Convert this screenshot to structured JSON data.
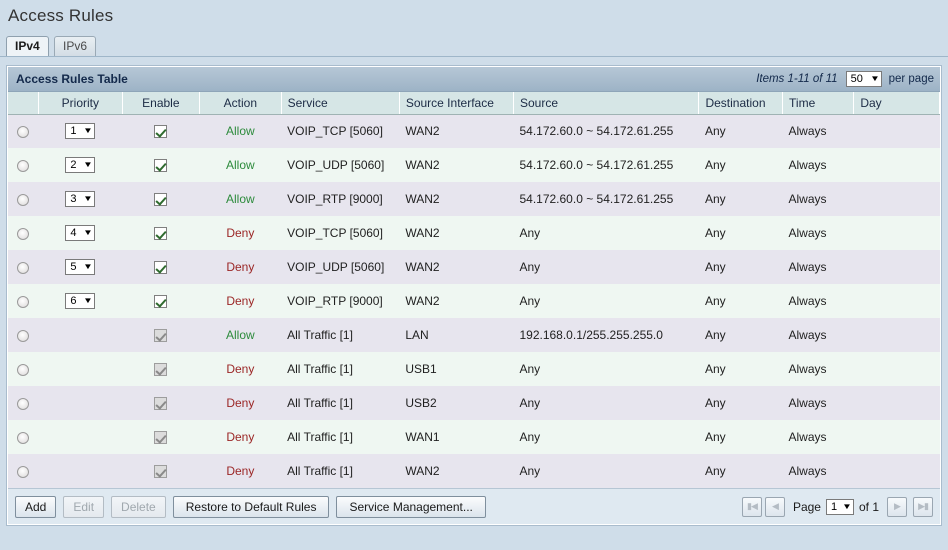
{
  "page": {
    "title": "Access Rules"
  },
  "tabs": [
    {
      "label": "IPv4",
      "active": true
    },
    {
      "label": "IPv6",
      "active": false
    }
  ],
  "table": {
    "caption": "Access Rules Table",
    "items_count": "Items 1-11 of 11",
    "page_size": "50",
    "per_page_label": "per page",
    "columns": [
      "",
      "Priority",
      "Enable",
      "Action",
      "Service",
      "Source Interface",
      "Source",
      "Destination",
      "Time",
      "Day"
    ],
    "rows": [
      {
        "priority": "1",
        "enable": true,
        "enable_disabled": false,
        "action": "Allow",
        "service": "VOIP_TCP [5060]",
        "source_interface": "WAN2",
        "source": "54.172.60.0 ~ 54.172.61.255",
        "destination": "Any",
        "time": "Always",
        "day": ""
      },
      {
        "priority": "2",
        "enable": true,
        "enable_disabled": false,
        "action": "Allow",
        "service": "VOIP_UDP [5060]",
        "source_interface": "WAN2",
        "source": "54.172.60.0 ~ 54.172.61.255",
        "destination": "Any",
        "time": "Always",
        "day": ""
      },
      {
        "priority": "3",
        "enable": true,
        "enable_disabled": false,
        "action": "Allow",
        "service": "VOIP_RTP [9000]",
        "source_interface": "WAN2",
        "source": "54.172.60.0 ~ 54.172.61.255",
        "destination": "Any",
        "time": "Always",
        "day": ""
      },
      {
        "priority": "4",
        "enable": true,
        "enable_disabled": false,
        "action": "Deny",
        "service": "VOIP_TCP [5060]",
        "source_interface": "WAN2",
        "source": "Any",
        "destination": "Any",
        "time": "Always",
        "day": ""
      },
      {
        "priority": "5",
        "enable": true,
        "enable_disabled": false,
        "action": "Deny",
        "service": "VOIP_UDP [5060]",
        "source_interface": "WAN2",
        "source": "Any",
        "destination": "Any",
        "time": "Always",
        "day": ""
      },
      {
        "priority": "6",
        "enable": true,
        "enable_disabled": false,
        "action": "Deny",
        "service": "VOIP_RTP [9000]",
        "source_interface": "WAN2",
        "source": "Any",
        "destination": "Any",
        "time": "Always",
        "day": ""
      },
      {
        "priority": null,
        "enable": true,
        "enable_disabled": true,
        "action": "Allow",
        "service": "All Traffic [1]",
        "source_interface": "LAN",
        "source": "192.168.0.1/255.255.255.0",
        "destination": "Any",
        "time": "Always",
        "day": ""
      },
      {
        "priority": null,
        "enable": true,
        "enable_disabled": true,
        "action": "Deny",
        "service": "All Traffic [1]",
        "source_interface": "USB1",
        "source": "Any",
        "destination": "Any",
        "time": "Always",
        "day": ""
      },
      {
        "priority": null,
        "enable": true,
        "enable_disabled": true,
        "action": "Deny",
        "service": "All Traffic [1]",
        "source_interface": "USB2",
        "source": "Any",
        "destination": "Any",
        "time": "Always",
        "day": ""
      },
      {
        "priority": null,
        "enable": true,
        "enable_disabled": true,
        "action": "Deny",
        "service": "All Traffic [1]",
        "source_interface": "WAN1",
        "source": "Any",
        "destination": "Any",
        "time": "Always",
        "day": ""
      },
      {
        "priority": null,
        "enable": true,
        "enable_disabled": true,
        "action": "Deny",
        "service": "All Traffic [1]",
        "source_interface": "WAN2",
        "source": "Any",
        "destination": "Any",
        "time": "Always",
        "day": ""
      }
    ]
  },
  "toolbar": {
    "add_label": "Add",
    "edit_label": "Edit",
    "delete_label": "Delete",
    "restore_label": "Restore to Default Rules",
    "service_mgmt_label": "Service Management...",
    "edit_disabled": true,
    "delete_disabled": true
  },
  "pager": {
    "first_icon": "first-page-icon",
    "prev_icon": "previous-page-icon",
    "next_icon": "next-page-icon",
    "last_icon": "last-page-icon",
    "page_label": "Page",
    "current_page": "1",
    "of_label": "of 1"
  },
  "colors": {
    "allow": "#2d8b3c",
    "deny": "#9b2626",
    "page_bg": "#cfdde9",
    "caption_bg": "#a9bccd",
    "header_bg": "#d6e6e6",
    "row_odd": "#e7e5ee",
    "row_even": "#eff7f2"
  }
}
